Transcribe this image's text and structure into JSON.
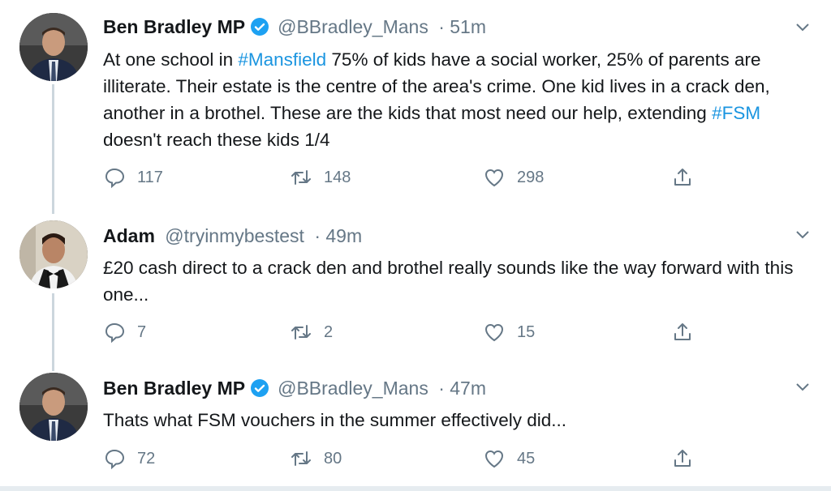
{
  "colors": {
    "link": "#1b95e0",
    "meta": "#657786",
    "text": "#14171a",
    "verified": "#1da1f2"
  },
  "tweets": [
    {
      "name": "Ben Bradley MP",
      "handle": "@BBradley_Mans",
      "time": "· 51m",
      "text": {
        "p1": "At one school in ",
        "tag1": "#Mansfield",
        "p2": " 75% of kids have a social worker, 25% of parents are illiterate. Their estate is the centre of the area's crime. One kid lives in a crack den, another in a brothel. These are the kids that most need our help, extending ",
        "tag2": "#FSM",
        "p3": " doesn't reach these kids 1/4"
      },
      "replies": "117",
      "retweets": "148",
      "likes": "298"
    },
    {
      "name": "Adam",
      "handle": "@tryinmybestest",
      "time": "· 49m",
      "text": "£20 cash direct to a crack den and brothel really sounds like the way forward with this one...",
      "replies": "7",
      "retweets": "2",
      "likes": "15"
    },
    {
      "name": "Ben Bradley MP",
      "handle": "@BBradley_Mans",
      "time": "· 47m",
      "text": "Thats what FSM vouchers in the summer effectively did...",
      "replies": "72",
      "retweets": "80",
      "likes": "45"
    }
  ],
  "icons": {
    "reply": "reply-icon",
    "retweet": "retweet-icon",
    "like": "heart-icon",
    "share": "share-icon",
    "caret": "chevron-down-icon",
    "verified": "verified-badge-icon"
  }
}
